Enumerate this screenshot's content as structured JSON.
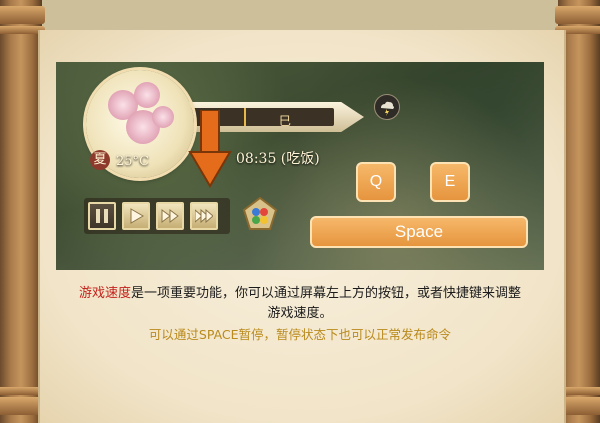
{
  "hud": {
    "season": "夏",
    "temperature": "25°C",
    "time_period": "巳",
    "time_text": "08:35 (吃饭)"
  },
  "speed_controls": {
    "buttons": [
      "pause",
      "play",
      "fast",
      "fastest"
    ]
  },
  "keys": {
    "q": "Q",
    "e": "E",
    "space": "Space"
  },
  "caption": {
    "highlight": "游戏速度",
    "body_line1": "是一项重要功能，你可以通过屏幕左上方的按钮，或者快捷键来调整",
    "body_line2": "游戏速度。",
    "note": "可以通过SPACE暂停，暂停状态下也可以正常发布命令"
  },
  "colors": {
    "highlight": "#c2221c",
    "note": "#b98a1c",
    "key_orange": "#f0a24e"
  }
}
